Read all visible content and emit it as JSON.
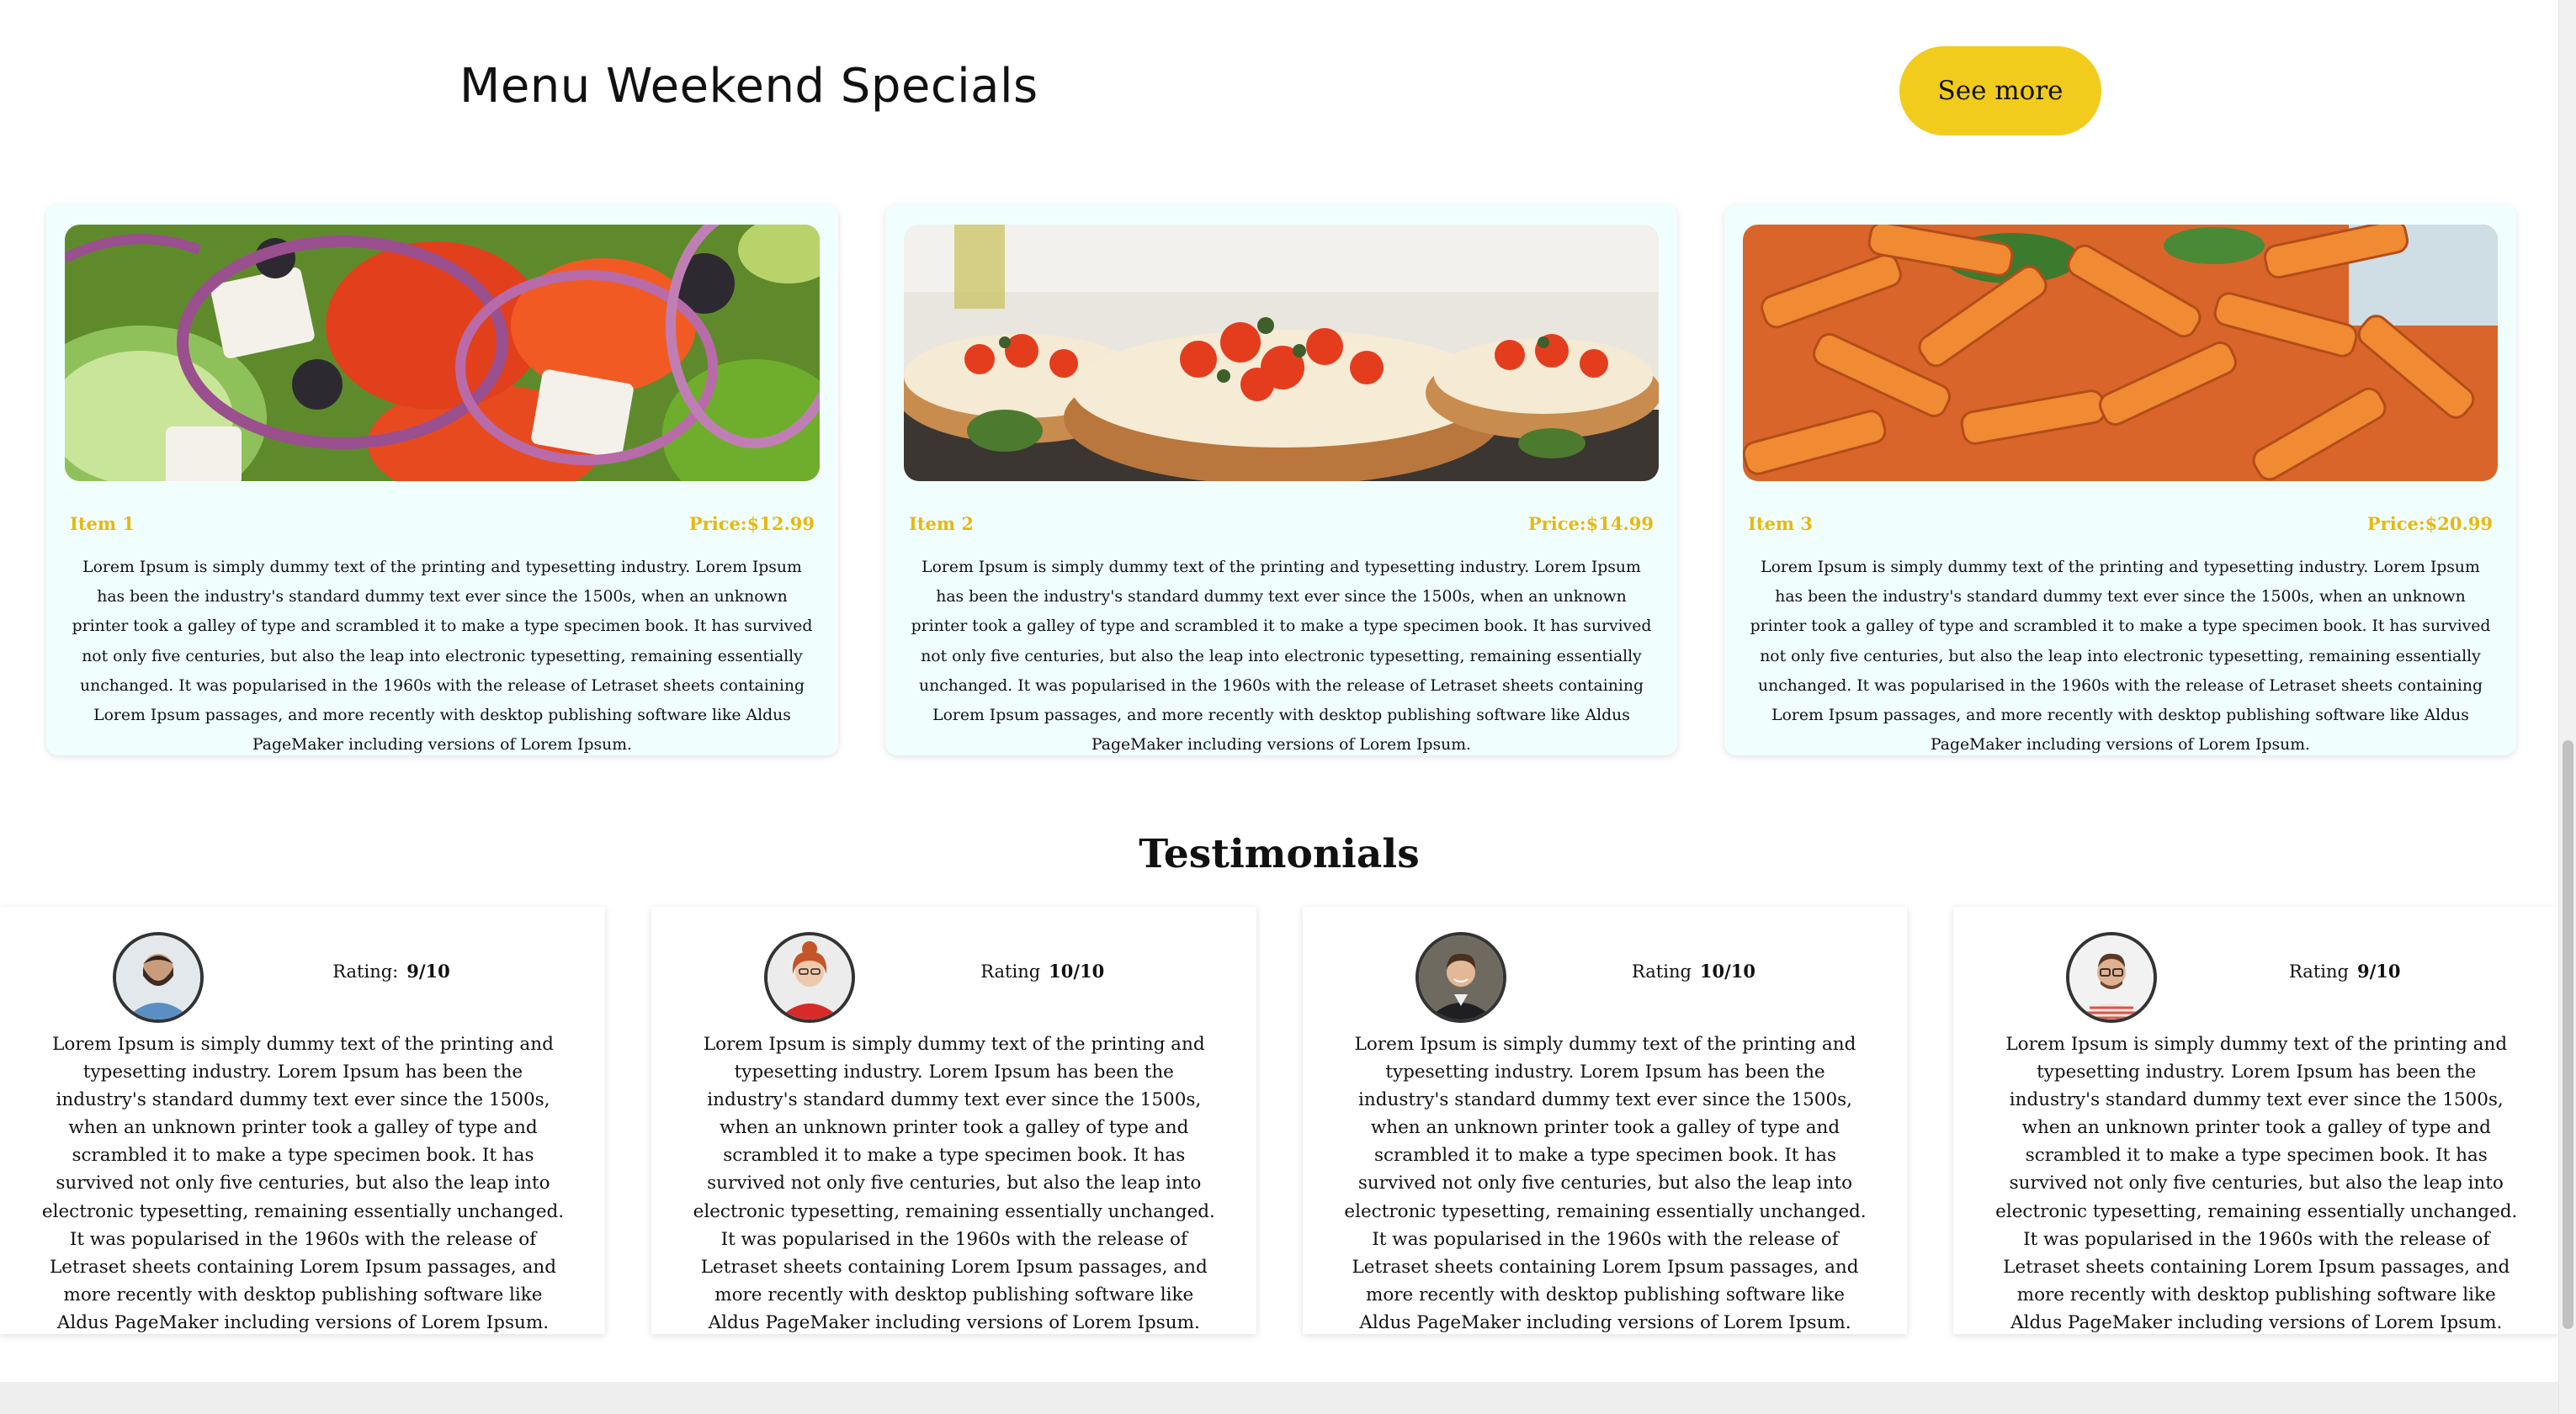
{
  "header": {
    "title": "Menu Weekend Specials",
    "see_more_label": "See more"
  },
  "colors": {
    "accent": "#f2cc1c",
    "card_background": "#f0fffe",
    "price_text": "#e8b810"
  },
  "menu": {
    "items": [
      {
        "name": "Item 1",
        "price": "Price:$12.99",
        "image": "greek-salad-image",
        "description": "Lorem Ipsum is simply dummy text of the printing and typesetting industry. Lorem Ipsum has been the industry's standard dummy text ever since the 1500s, when an unknown printer took a galley of type and scrambled it to make a type specimen book. It has survived not only five centuries, but also the leap into electronic typesetting, remaining essentially unchanged. It was popularised in the 1960s with the release of Letraset sheets containing Lorem Ipsum passages, and more recently with desktop publishing software like Aldus PageMaker including versions of Lorem Ipsum."
      },
      {
        "name": "Item 2",
        "price": "Price:$14.99",
        "image": "bruschetta-image",
        "description": "Lorem Ipsum is simply dummy text of the printing and typesetting industry. Lorem Ipsum has been the industry's standard dummy text ever since the 1500s, when an unknown printer took a galley of type and scrambled it to make a type specimen book. It has survived not only five centuries, but also the leap into electronic typesetting, remaining essentially unchanged. It was popularised in the 1960s with the release of Letraset sheets containing Lorem Ipsum passages, and more recently with desktop publishing software like Aldus PageMaker including versions of Lorem Ipsum."
      },
      {
        "name": "Item 3",
        "price": "Price:$20.99",
        "image": "penne-pasta-image",
        "description": "Lorem Ipsum is simply dummy text of the printing and typesetting industry. Lorem Ipsum has been the industry's standard dummy text ever since the 1500s, when an unknown printer took a galley of type and scrambled it to make a type specimen book. It has survived not only five centuries, but also the leap into electronic typesetting, remaining essentially unchanged. It was popularised in the 1960s with the release of Letraset sheets containing Lorem Ipsum passages, and more recently with desktop publishing software like Aldus PageMaker including versions of Lorem Ipsum."
      }
    ]
  },
  "testimonials": {
    "title": "Testimonials",
    "items": [
      {
        "rating_label": "Rating:",
        "rating_value": "9/10",
        "avatar": "bearded-man-avatar",
        "text": "Lorem Ipsum is simply dummy text of the printing and typesetting industry. Lorem Ipsum has been the industry's standard dummy text ever since the 1500s, when an unknown printer took a galley of type and scrambled it to make a type specimen book. It has survived not only five centuries, but also the leap into electronic typesetting, remaining essentially unchanged. It was popularised in the 1960s with the release of Letraset sheets containing Lorem Ipsum passages, and more recently with desktop publishing software like Aldus PageMaker including versions of Lorem Ipsum."
      },
      {
        "rating_label": "Rating",
        "rating_value": "10/10",
        "avatar": "red-haired-woman-avatar",
        "text": "Lorem Ipsum is simply dummy text of the printing and typesetting industry. Lorem Ipsum has been the industry's standard dummy text ever since the 1500s, when an unknown printer took a galley of type and scrambled it to make a type specimen book. It has survived not only five centuries, but also the leap into electronic typesetting, remaining essentially unchanged. It was popularised in the 1960s with the release of Letraset sheets containing Lorem Ipsum passages, and more recently with desktop publishing software like Aldus PageMaker including versions of Lorem Ipsum."
      },
      {
        "rating_label": "Rating",
        "rating_value": "10/10",
        "avatar": "smiling-man-avatar",
        "text": "Lorem Ipsum is simply dummy text of the printing and typesetting industry. Lorem Ipsum has been the industry's standard dummy text ever since the 1500s, when an unknown printer took a galley of type and scrambled it to make a type specimen book. It has survived not only five centuries, but also the leap into electronic typesetting, remaining essentially unchanged. It was popularised in the 1960s with the release of Letraset sheets containing Lorem Ipsum passages, and more recently with desktop publishing software like Aldus PageMaker including versions of Lorem Ipsum."
      },
      {
        "rating_label": "Rating",
        "rating_value": "9/10",
        "avatar": "glasses-man-avatar",
        "text": "Lorem Ipsum is simply dummy text of the printing and typesetting industry. Lorem Ipsum has been the industry's standard dummy text ever since the 1500s, when an unknown printer took a galley of type and scrambled it to make a type specimen book. It has survived not only five centuries, but also the leap into electronic typesetting, remaining essentially unchanged. It was popularised in the 1960s with the release of Letraset sheets containing Lorem Ipsum passages, and more recently with desktop publishing software like Aldus PageMaker including versions of Lorem Ipsum."
      }
    ]
  }
}
